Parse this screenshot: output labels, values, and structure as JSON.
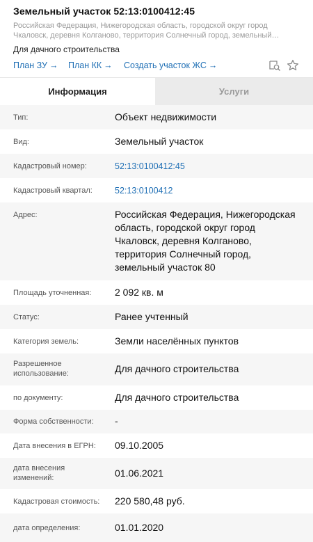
{
  "header": {
    "title": "Земельный участок 52:13:0100412:45",
    "address_short": "Российская Федерация, Нижегородская область, городской округ город Чкаловск, деревня Колганово, территория Солнечный город, земельный…",
    "purpose": "Для дачного строительства",
    "links": [
      {
        "label": "План ЗУ"
      },
      {
        "label": "План КК"
      },
      {
        "label": "Создать участок ЖС"
      }
    ],
    "arrow_glyph": "→",
    "icons": [
      "zoom-to-object-icon",
      "star-icon"
    ]
  },
  "tabs": [
    {
      "label": "Информация",
      "active": true
    },
    {
      "label": "Услуги",
      "active": false
    }
  ],
  "info": {
    "rows": [
      {
        "label": "Тип:",
        "value": "Объект недвижимости"
      },
      {
        "label": "Вид:",
        "value": "Земельный участок"
      },
      {
        "label": "Кадастровый номер:",
        "value": "52:13:0100412:45"
      },
      {
        "label": "Кадастровый квартал:",
        "value": "52:13:0100412"
      },
      {
        "label": "Адрес:",
        "value": "Российская Федерация, Нижегородская область, городской округ город Чкаловск, деревня Колганово, территория Солнечный город, земельный участок 80"
      },
      {
        "label": "Площадь уточненная:",
        "value": "2 092 кв. м"
      },
      {
        "label": "Статус:",
        "value": "Ранее учтенный"
      },
      {
        "label": "Категория земель:",
        "value": "Земли населённых пунктов"
      },
      {
        "label": "Разрешенное использование:",
        "value": "Для дачного строительства"
      },
      {
        "label": "по документу:",
        "value": "Для дачного строительства"
      },
      {
        "label": "Форма собственности:",
        "value": "-"
      },
      {
        "label": "Дата внесения в ЕГРН:",
        "value": "09.10.2005"
      },
      {
        "label": "дата внесения изменений:",
        "value": "01.06.2021"
      },
      {
        "label": "Кадастровая стоимость:",
        "value": "220 580,48 руб."
      },
      {
        "label": "дата определения:",
        "value": "01.01.2020"
      }
    ]
  },
  "colors": {
    "link": "#1f6fb5",
    "row_alt": "#f6f6f6",
    "tab_inactive_bg": "#ebebeb"
  }
}
